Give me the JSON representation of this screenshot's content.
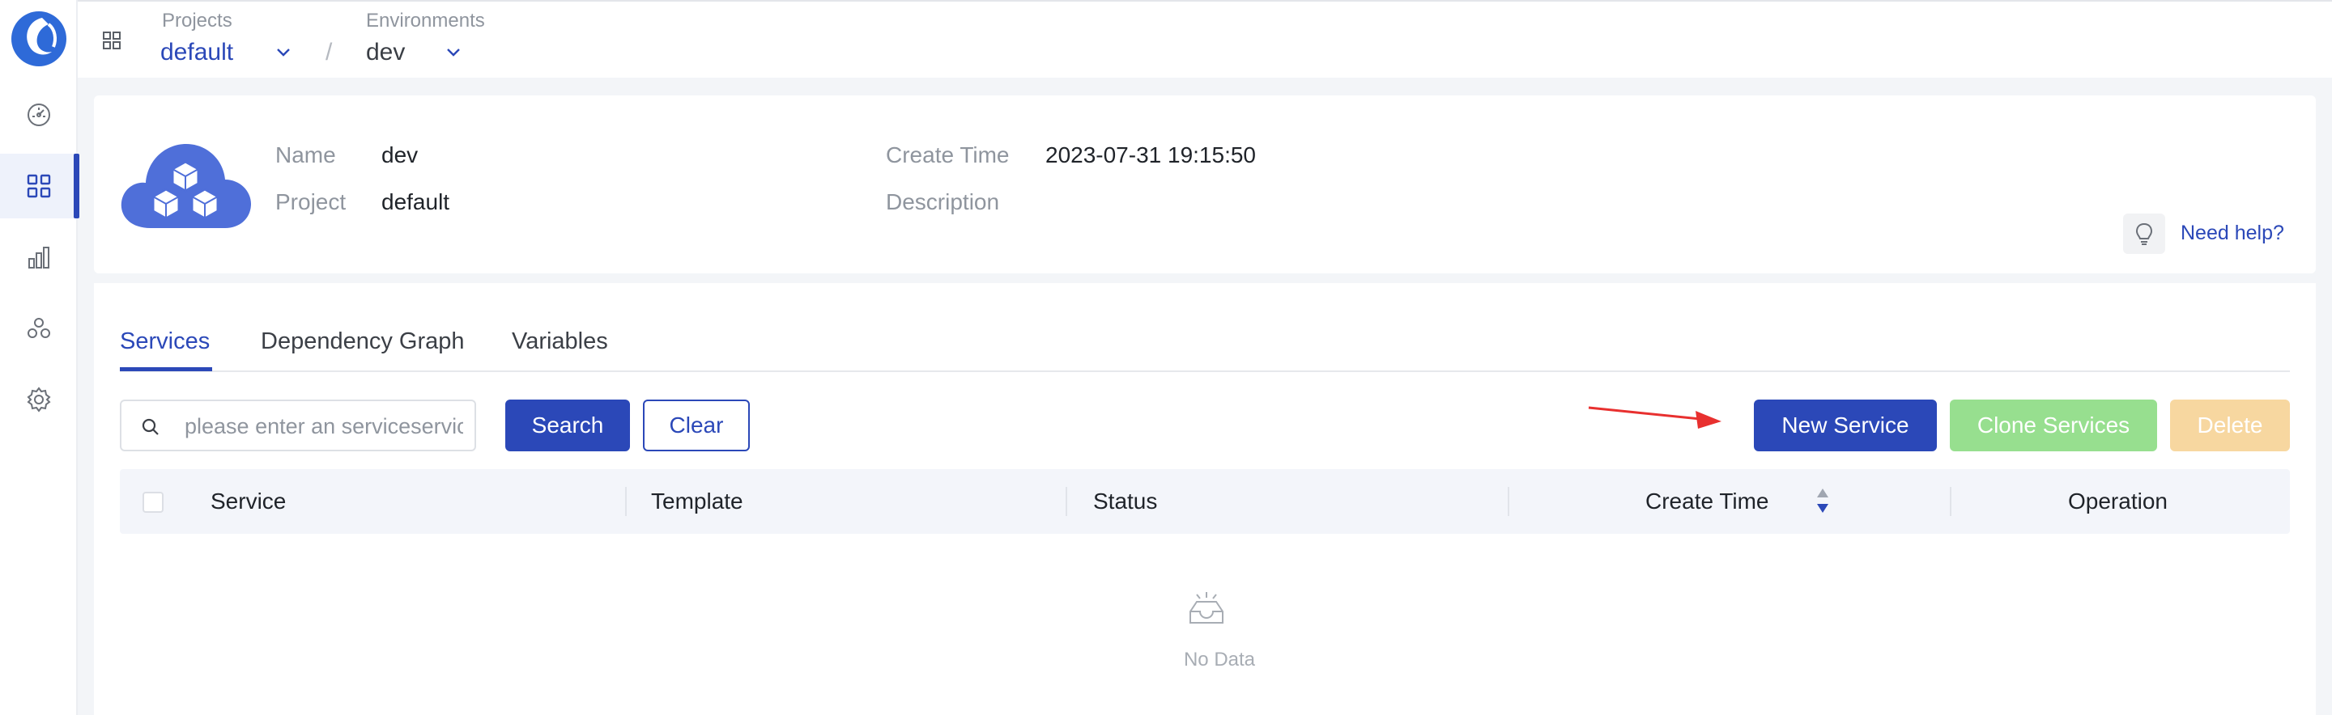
{
  "topbar": {
    "projects_label": "Projects",
    "project_value": "default",
    "separator": "/",
    "environments_label": "Environments",
    "environment_value": "dev"
  },
  "sidebar": {
    "items": [
      {
        "icon": "dashboard-icon"
      },
      {
        "icon": "apps-grid-icon",
        "active": true
      },
      {
        "icon": "bar-chart-icon"
      },
      {
        "icon": "cluster-icon"
      },
      {
        "icon": "gear-icon"
      }
    ]
  },
  "env_info": {
    "name_label": "Name",
    "name_value": "dev",
    "project_label": "Project",
    "project_value": "default",
    "create_time_label": "Create Time",
    "create_time_value": "2023-07-31 19:15:50",
    "description_label": "Description",
    "help_link": "Need help?"
  },
  "tabs": [
    {
      "label": "Services",
      "active": true
    },
    {
      "label": "Dependency Graph"
    },
    {
      "label": "Variables"
    }
  ],
  "toolbar": {
    "search_placeholder": "please enter an serviceservice name",
    "search_button": "Search",
    "clear_button": "Clear",
    "new_service_button": "New Service",
    "clone_services_button": "Clone Services",
    "delete_button": "Delete"
  },
  "table": {
    "columns": [
      "Service",
      "Template",
      "Status",
      "Create Time",
      "Operation"
    ],
    "rows": [],
    "empty_text": "No Data"
  },
  "colors": {
    "primary": "#2b48b8",
    "success_disabled": "#97df8f",
    "danger_disabled": "#f7d7a0",
    "arrow": "#e8302f"
  }
}
